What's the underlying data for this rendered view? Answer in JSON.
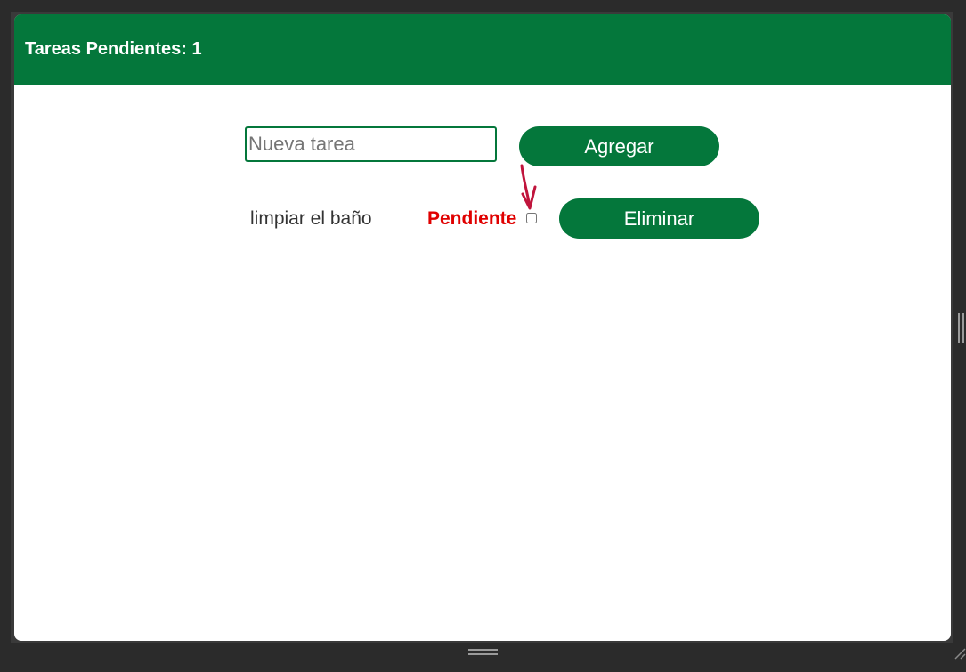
{
  "header": {
    "title": "Tareas Pendientes: 1"
  },
  "form": {
    "input_placeholder": "Nueva tarea",
    "input_value": "",
    "add_label": "Agregar"
  },
  "tasks": [
    {
      "text": "limpiar el baño",
      "status": "Pendiente",
      "checked": false,
      "delete_label": "Eliminar"
    }
  ],
  "colors": {
    "brand_green": "#04773b",
    "status_pending": "#e00000",
    "annotation_arrow": "#c0143c"
  }
}
